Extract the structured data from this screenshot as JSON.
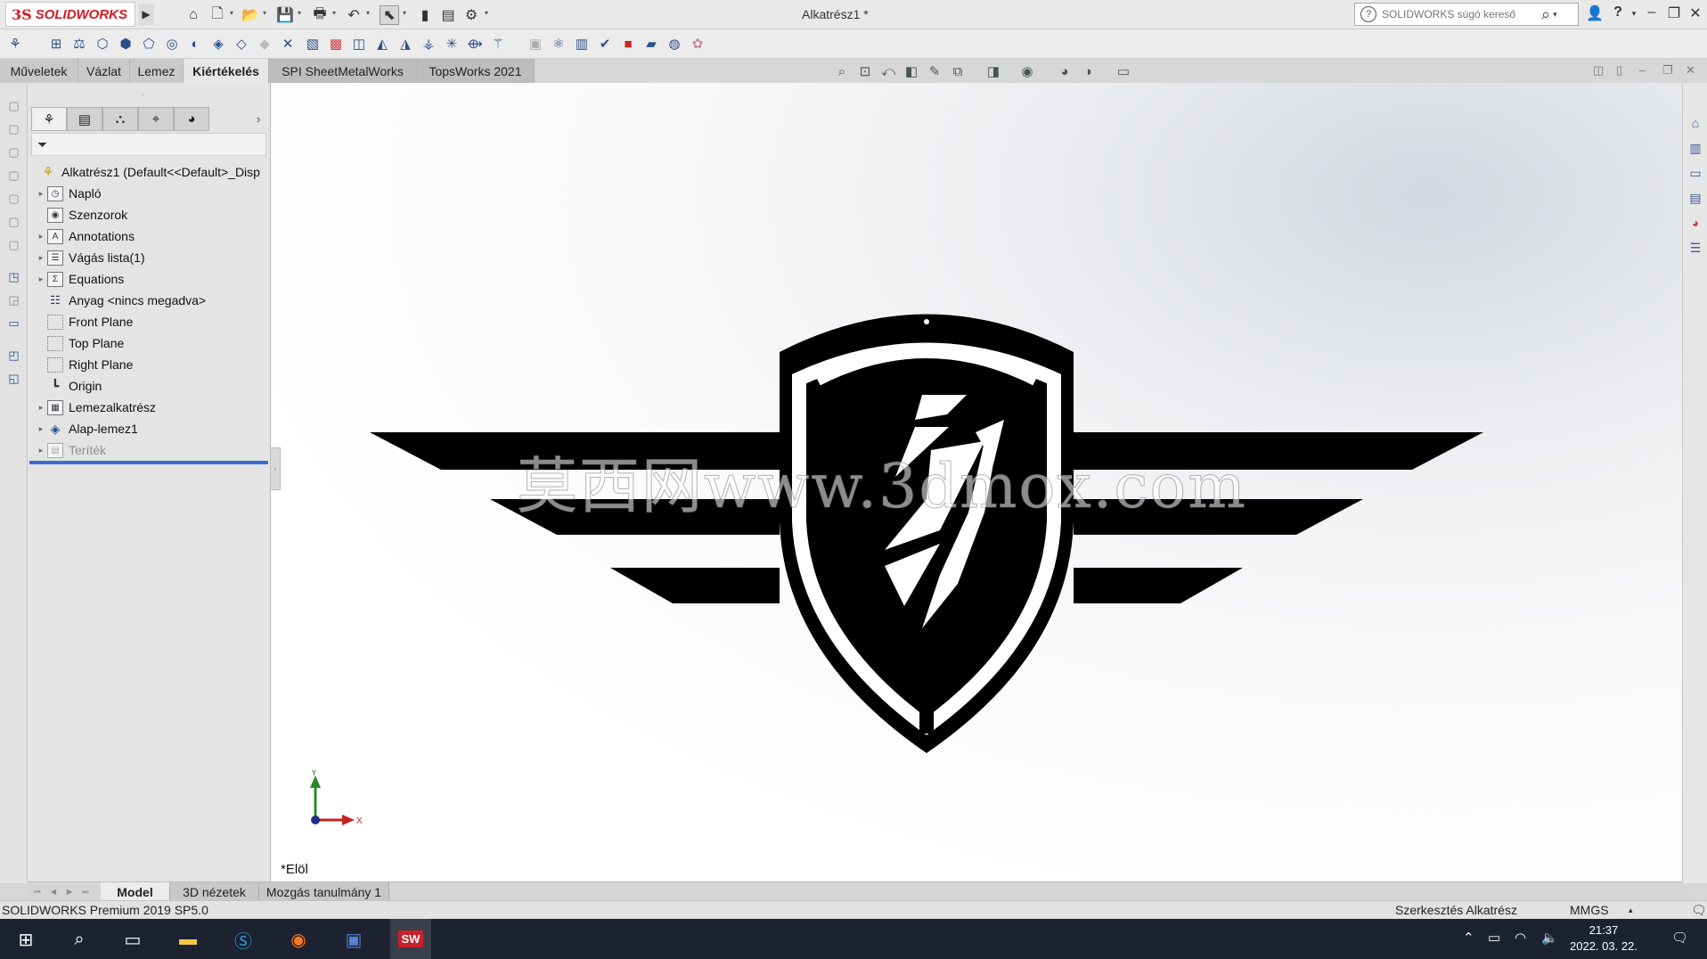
{
  "window": {
    "title": "Alkatrész1 *",
    "brand": {
      "ds": "3S",
      "name": "SOLIDWORKS"
    },
    "search_placeholder": "SOLIDWORKS súgó kereső",
    "help_label": "?"
  },
  "command_tabs": [
    {
      "label": "Műveletek",
      "active": false
    },
    {
      "label": "Vázlat",
      "active": false
    },
    {
      "label": "Lemez",
      "active": false
    },
    {
      "label": "Kiértékelés",
      "active": true
    },
    {
      "label": "SPI SheetMetalWorks",
      "active": false
    },
    {
      "label": "TopsWorks 2021",
      "active": false
    }
  ],
  "feature_tree": {
    "root": "Alkatrész1  (Default<<Default>_Disp",
    "items": [
      {
        "label": "Napló",
        "icon": "folder-icon",
        "expandable": true
      },
      {
        "label": "Szenzorok",
        "icon": "sensor-icon",
        "expandable": false
      },
      {
        "label": "Annotations",
        "icon": "annotations-icon",
        "expandable": true
      },
      {
        "label": "Vágás lista(1)",
        "icon": "cutlist-icon",
        "expandable": true
      },
      {
        "label": "Equations",
        "icon": "equations-icon",
        "expandable": true
      },
      {
        "label": "Anyag <nincs megadva>",
        "icon": "material-icon",
        "expandable": false
      },
      {
        "label": "Front Plane",
        "icon": "plane-icon",
        "expandable": false
      },
      {
        "label": "Top Plane",
        "icon": "plane-icon",
        "expandable": false
      },
      {
        "label": "Right Plane",
        "icon": "plane-icon",
        "expandable": false
      },
      {
        "label": "Origin",
        "icon": "origin-icon",
        "expandable": false
      },
      {
        "label": "Lemezalkatrész",
        "icon": "sheetmetal-icon",
        "expandable": true
      },
      {
        "label": "Alap-lemez1",
        "icon": "base-flange-icon",
        "expandable": true
      },
      {
        "label": "Teríték",
        "icon": "flat-pattern-icon",
        "expandable": true,
        "suppressed": true
      }
    ]
  },
  "viewport": {
    "view_label": "*Elöl",
    "watermark": "莫西网www.3dmox.com",
    "triad": {
      "y": "Y",
      "x": "X"
    }
  },
  "bottom_tabs": [
    {
      "label": "Model",
      "active": true
    },
    {
      "label": "3D nézetek",
      "active": false
    },
    {
      "label": "Mozgás tanulmány 1",
      "active": false
    }
  ],
  "status_bar": {
    "product": "SOLIDWORKS Premium 2019 SP5.0",
    "mode": "Szerkesztés Alkatrész",
    "units": "MMGS"
  },
  "taskbar": {
    "time": "21:37",
    "date": "2022. 03. 22."
  },
  "colors": {
    "accent_red": "#d71920",
    "rollback_bar": "#3c6bd3",
    "taskbar": "#1c2230"
  }
}
